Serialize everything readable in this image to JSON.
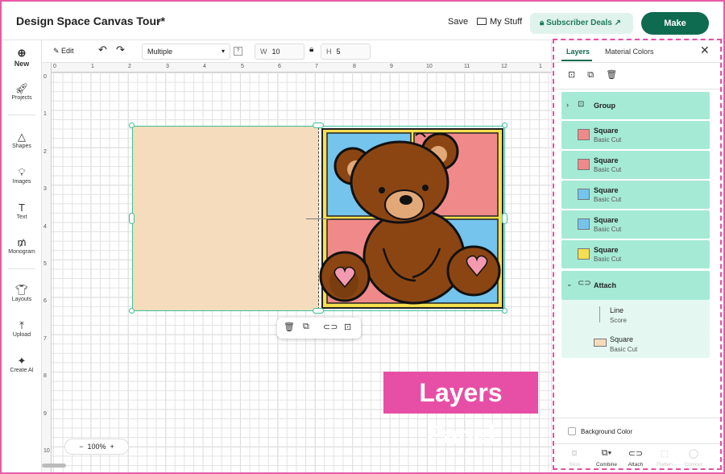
{
  "header": {
    "title": "Design Space Canvas Tour*",
    "save_label": "Save",
    "my_stuff_label": "My Stuff",
    "subscriber_deals_label": "Subscriber Deals",
    "make_label": "Make"
  },
  "left_nav": [
    {
      "label": "New",
      "icon": "plus-circle-icon"
    },
    {
      "label": "Projects",
      "icon": "rocket-icon"
    },
    {
      "label": "Shapes",
      "icon": "shapes-icon"
    },
    {
      "label": "Images",
      "icon": "lightbulb-icon"
    },
    {
      "label": "Text",
      "icon": "text-icon"
    },
    {
      "label": "Monogram",
      "icon": "monogram-icon"
    },
    {
      "label": "Layouts",
      "icon": "shirt-icon"
    },
    {
      "label": "Upload",
      "icon": "upload-icon"
    },
    {
      "label": "Create AI",
      "icon": "sparkle-icon"
    }
  ],
  "toolbar": {
    "edit_label": "Edit",
    "operation_value": "Multiple",
    "width_label": "W",
    "width_value": "10",
    "height_label": "H",
    "height_value": "5"
  },
  "ruler": {
    "top": [
      "0",
      "1",
      "2",
      "3",
      "4",
      "5",
      "6",
      "7",
      "8",
      "9",
      "10",
      "11",
      "12",
      "1"
    ],
    "left": [
      "0",
      "1",
      "2",
      "3",
      "4",
      "5",
      "6",
      "7",
      "8",
      "9",
      "10"
    ]
  },
  "canvas": {
    "zoom": "100%",
    "annotation": "Layers Panel"
  },
  "panel": {
    "tabs": [
      "Layers",
      "Material Colors"
    ],
    "layers": [
      {
        "name": "Group",
        "type": "",
        "color": "",
        "kind": "group"
      },
      {
        "name": "Square",
        "type": "Basic Cut",
        "color": "#f08a8a",
        "kind": "item"
      },
      {
        "name": "Square",
        "type": "Basic Cut",
        "color": "#f08a8a",
        "kind": "item"
      },
      {
        "name": "Square",
        "type": "Basic Cut",
        "color": "#74c4ee",
        "kind": "item"
      },
      {
        "name": "Square",
        "type": "Basic Cut",
        "color": "#74c4ee",
        "kind": "item"
      },
      {
        "name": "Square",
        "type": "Basic Cut",
        "color": "#f6df4e",
        "kind": "item"
      },
      {
        "name": "Attach",
        "type": "",
        "color": "",
        "kind": "attach"
      },
      {
        "name": "Line",
        "type": "Score",
        "color": "",
        "kind": "sub"
      },
      {
        "name": "Square",
        "type": "Basic Cut",
        "color": "#f5dcbc",
        "kind": "sub"
      }
    ],
    "background_color_label": "Background Color",
    "bottom_actions": [
      "Slice",
      "Combine",
      "Attach",
      "Flatten",
      "Contour"
    ]
  }
}
